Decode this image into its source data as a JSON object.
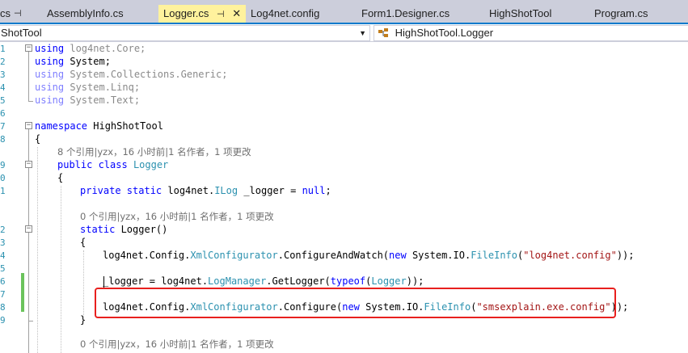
{
  "tabs": {
    "partial_left": "cs",
    "items": [
      "AssemblyInfo.cs",
      "Logger.cs",
      "Log4net.config",
      "Form1.Designer.cs",
      "HighShotTool",
      "Program.cs"
    ],
    "active_index": 1,
    "pin_glyph": "⊣",
    "close_glyph": "✕"
  },
  "navbar": {
    "left_combo": "ShotTool",
    "right_combo": "HighShotTool.Logger"
  },
  "gutter": [
    "1",
    "2",
    "3",
    "4",
    "5",
    "6",
    "7",
    "8",
    "",
    "9",
    "0",
    "1",
    "",
    "2",
    "3",
    "4",
    "5",
    "6",
    "7",
    "8",
    "9",
    "0",
    "",
    ""
  ],
  "code": {
    "using1_kw": "using",
    "using1_ns": " log4net.Core;",
    "using2_kw": "using",
    "using2_ns": " System;",
    "using3_kw": "using",
    "using3_ns": " System.Collections.Generic;",
    "using4_kw": "using",
    "using4_ns": " System.Linq;",
    "using5_kw": "using",
    "using5_ns": " System.Text;",
    "ns_kw": "namespace",
    "ns_name": " HighShotTool",
    "brace_open": "{",
    "brace_close": "}",
    "lens1": "8 个引用|yzx，16 小时前|1 名作者，1 项更改",
    "class_kw": "public class",
    "class_name": "Logger",
    "field_kw": "private static",
    "field_mid": " log4net.",
    "field_type": "ILog",
    "field_rest": " _logger = ",
    "field_null": "null",
    "field_end": ";",
    "lens2": "0 个引用|yzx，16 小时前|1 名作者，1 项更改",
    "ctor_kw": "static",
    "ctor_rest": " Logger()",
    "line_caw_a": "log4net.Config.",
    "line_caw_type": "XmlConfigurator",
    "line_caw_b": ".ConfigureAndWatch(",
    "line_caw_new": "new",
    "line_caw_c": " System.IO.",
    "line_caw_fi": "FileInfo",
    "line_caw_d": "(",
    "line_caw_str": "\"log4net.config\"",
    "line_caw_e": "));",
    "line_lm_a": "_logger = log4net.",
    "line_lm_type": "LogManager",
    "line_lm_b": ".GetLogger(",
    "line_lm_typeof": "typeof",
    "line_lm_c": "(",
    "line_lm_logger": "Logger",
    "line_lm_d": "));",
    "line_cf_a": "log4net.Config.",
    "line_cf_type": "XmlConfigurator",
    "line_cf_b": ".Configure(",
    "line_cf_new": "new",
    "line_cf_c": " System.IO.",
    "line_cf_fi": "FileInfo",
    "line_cf_d": "(",
    "line_cf_str": "\"smsexplain.exe.config\"",
    "line_cf_e": "));",
    "lens3": "0 个引用|yzx，16 小时前|1 名作者，1 项更改"
  },
  "colors": {
    "keyword": "#0000ff",
    "type": "#2b91af",
    "string": "#a31515",
    "highlight_box": "#e8201e",
    "active_tab": "#fff29d",
    "change_bar": "#6bc35c"
  }
}
